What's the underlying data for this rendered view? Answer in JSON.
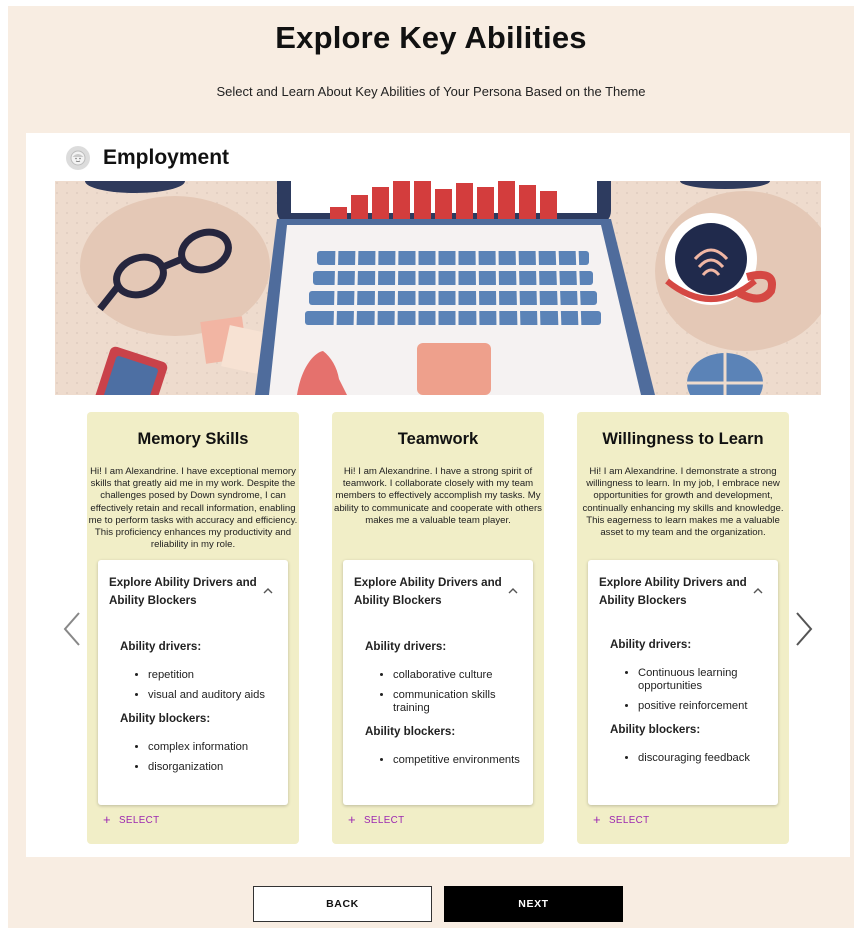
{
  "header": {
    "title": "Explore Key Abilities",
    "subtitle": "Select and Learn About Key Abilities of Your Persona Based on the Theme"
  },
  "theme": {
    "title": "Employment",
    "icon": "persona-face-icon",
    "banner": "laptop-desk-illustration"
  },
  "cards": [
    {
      "title": "Memory Skills",
      "description": "Hi! I am Alexandrine. I have exceptional memory skills that greatly aid me in my work. Despite the challenges posed by Down syndrome, I can effectively retain and recall information, enabling me to perform tasks with accuracy and efficiency. This proficiency enhances my productivity and reliability in my role.",
      "accordion_title": "Explore Ability Drivers and Ability Blockers",
      "drivers_label": "Ability drivers:",
      "drivers": [
        "repetition",
        "visual and auditory aids"
      ],
      "blockers_label": "Ability blockers:",
      "blockers": [
        "complex information",
        "disorganization"
      ],
      "select_label": "SELECT"
    },
    {
      "title": "Teamwork",
      "description": "Hi! I am Alexandrine. I have a strong spirit of teamwork. I collaborate closely with my team members to effectively accomplish my tasks. My ability to communicate and cooperate with others makes me a valuable team player.",
      "accordion_title": "Explore Ability Drivers and Ability Blockers",
      "drivers_label": "Ability drivers:",
      "drivers": [
        "collaborative culture",
        "communication skills training"
      ],
      "blockers_label": "Ability blockers:",
      "blockers": [
        "competitive environments"
      ],
      "select_label": "SELECT"
    },
    {
      "title": "Willingness to Learn",
      "description": "Hi! I am Alexandrine. I demonstrate a strong willingness to learn. In my job, I embrace new opportunities for growth and development, continually enhancing my skills and knowledge. This eagerness to learn makes me a valuable asset to my team and the organization.",
      "accordion_title": "Explore Ability Drivers and Ability Blockers",
      "drivers_label": "Ability drivers:",
      "drivers": [
        "Continuous learning opportunities",
        "positive reinforcement"
      ],
      "blockers_label": "Ability blockers:",
      "blockers": [
        "discouraging feedback"
      ],
      "select_label": "SELECT"
    }
  ],
  "navigation": {
    "back_label": "BACK",
    "next_label": "NEXT"
  },
  "colors": {
    "page_background": "#f8ede2",
    "card_background": "#f1eec7",
    "select_accent": "#9c27b0",
    "next_button": "#000000"
  }
}
